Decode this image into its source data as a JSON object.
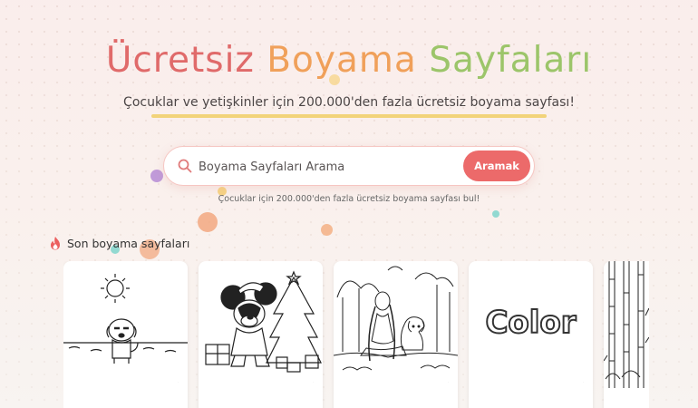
{
  "hero": {
    "title_part1": "Ücretsiz",
    "title_part2": "Boyama",
    "title_part3": "Sayfaları",
    "subtitle": "Çocuklar ve yetişkinler için 200.000'den fazla ücretsiz boyama sayfası!"
  },
  "search": {
    "placeholder": "Boyama Sayfaları Arama",
    "button_label": "Aramak",
    "hint": "Çocuklar için 200.000'den fazla ücretsiz boyama sayfası bul!"
  },
  "recent": {
    "section_title": "Son boyama sayfaları",
    "section_icon": "fire-icon",
    "cards": [
      {
        "subject": "puppy-sun-beach"
      },
      {
        "subject": "mouse-christmas-tree"
      },
      {
        "subject": "girl-dog-forest"
      },
      {
        "subject": "color-lettering",
        "text": "Color"
      },
      {
        "subject": "bamboo-forest"
      }
    ]
  },
  "colors": {
    "accent": "#ec6a6a",
    "title_red": "#e06a6a",
    "title_orange": "#f0a05a",
    "title_green": "#9cc56a",
    "underline": "#f2d37a"
  }
}
